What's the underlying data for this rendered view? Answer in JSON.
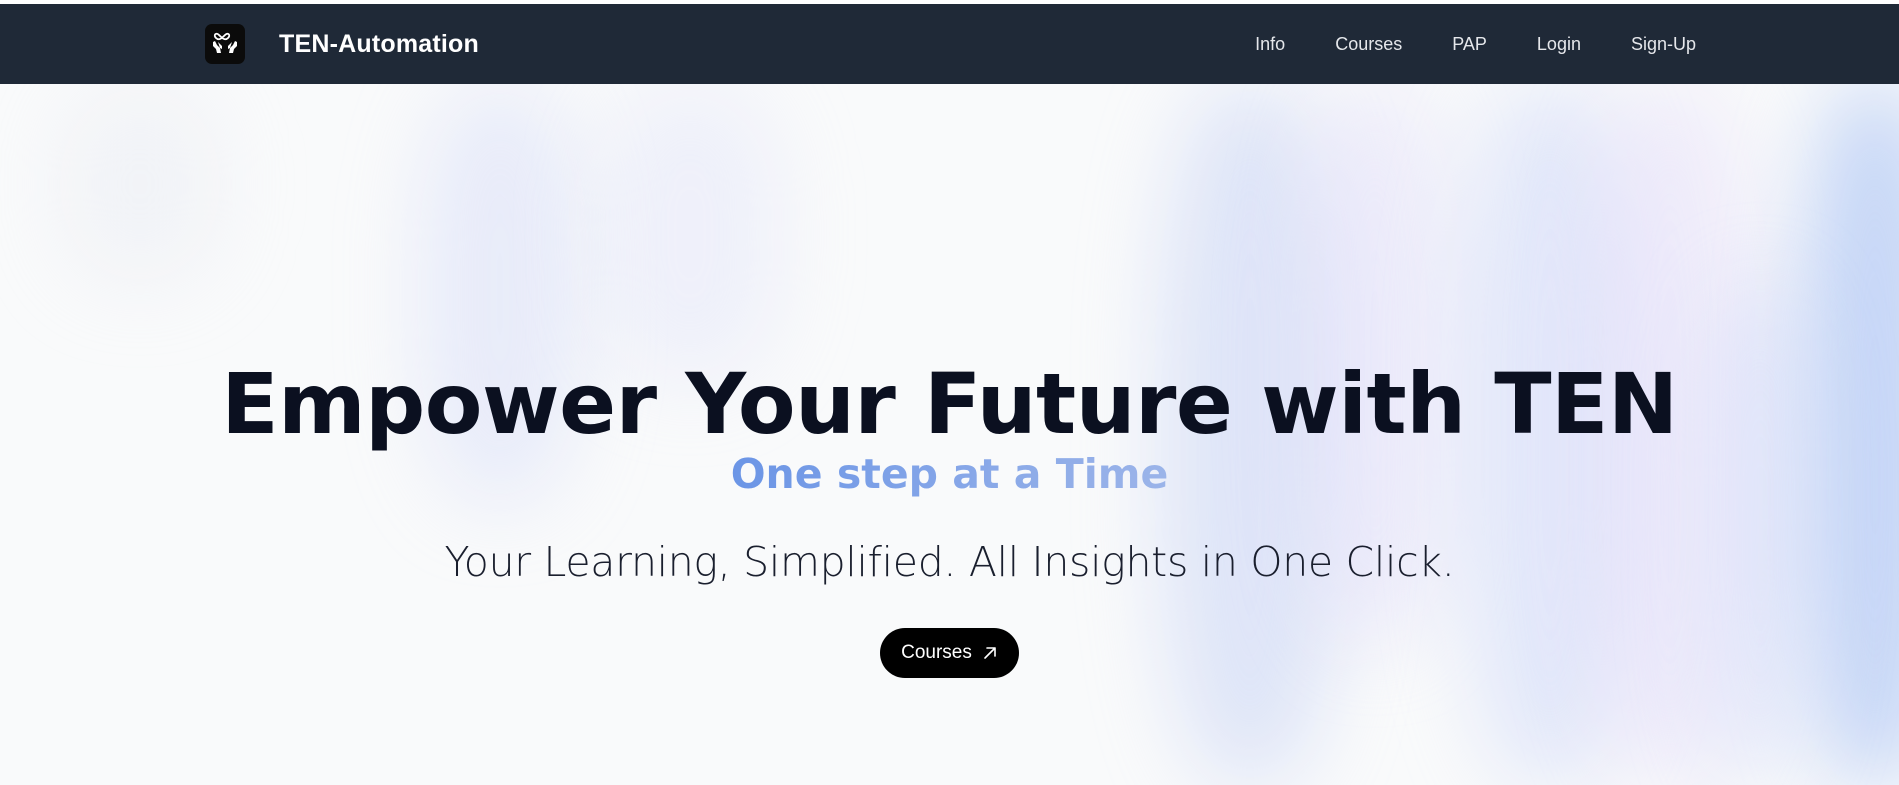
{
  "brand": {
    "name": "TEN-Automation",
    "logo_icon": "hands-infinity-icon"
  },
  "nav": {
    "items": [
      {
        "label": "Info"
      },
      {
        "label": "Courses"
      },
      {
        "label": "PAP"
      },
      {
        "label": "Login"
      },
      {
        "label": "Sign-Up"
      }
    ]
  },
  "hero": {
    "headline": "Empower Your Future with TEN",
    "subheadline": "One step at a Time",
    "tagline": "Your Learning, Simplified. All Insights in One Click.",
    "cta_label": "Courses",
    "cta_icon": "arrow-up-right-icon"
  },
  "colors": {
    "navbar_bg": "#1f2937",
    "accent_gradient_start": "#6b95e6",
    "accent_gradient_end": "#9bb4e9",
    "cta_bg": "#000000"
  }
}
